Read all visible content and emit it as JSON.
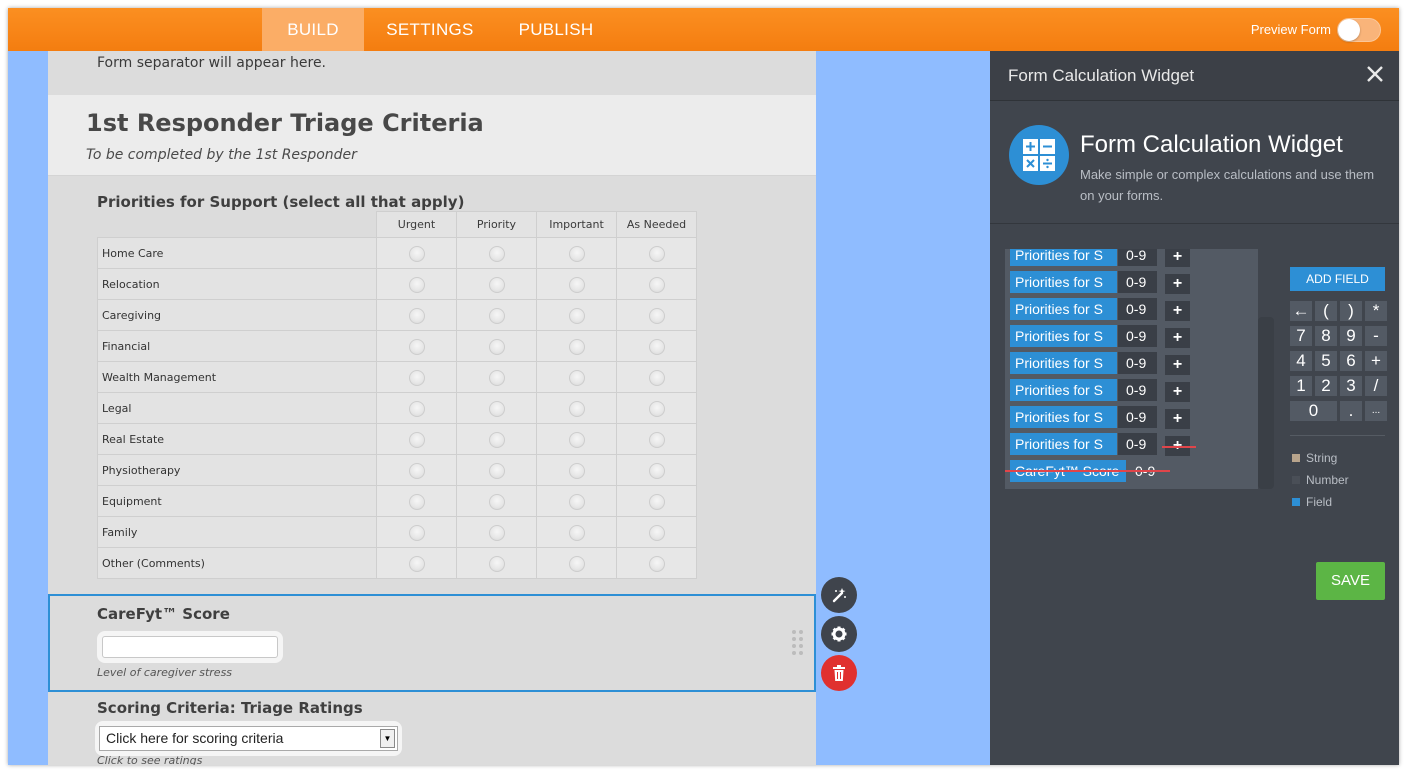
{
  "topbar": {
    "tabs": [
      {
        "label": "BUILD"
      },
      {
        "label": "SETTINGS"
      },
      {
        "label": "PUBLISH"
      }
    ],
    "preview_label": "Preview Form",
    "accent": "#f58512",
    "active_tab": "BUILD"
  },
  "form": {
    "separator_text": "Form separator will appear here.",
    "title": "1st Responder Triage Criteria",
    "subtitle": "To be completed by the 1st Responder",
    "priorities": {
      "label": "Priorities for Support (select all that apply)",
      "columns": [
        "Urgent",
        "Priority",
        "Important",
        "As Needed"
      ],
      "rows": [
        "Home Care",
        "Relocation",
        "Caregiving",
        "Financial",
        "Wealth Management",
        "Legal",
        "Real Estate",
        "Physiotherapy",
        "Equipment",
        "Family",
        "Other (Comments)"
      ]
    },
    "score": {
      "label": "CareFyt™ Score",
      "value": "",
      "sublabel": "Level of caregiver stress"
    },
    "scoring": {
      "label": "Scoring Criteria: Triage Ratings",
      "selected": "Click here for scoring criteria",
      "sublabel": "Click to see ratings"
    }
  },
  "tools": {
    "wand_icon": "magic-wand-icon",
    "gear_icon": "gear-icon",
    "trash_icon": "trash-icon",
    "delete_color": "#e0312f"
  },
  "panel": {
    "title": "Form Calculation Widget",
    "widget_name": "Form Calculation Widget",
    "widget_desc": "Make simple or complex calculations and use them on your forms.",
    "add_field_label": "ADD FIELD",
    "calc_rows": [
      {
        "field": "Priorities for S",
        "num": "0-9",
        "op": "+"
      },
      {
        "field": "Priorities for S",
        "num": "0-9",
        "op": "+"
      },
      {
        "field": "Priorities for S",
        "num": "0-9",
        "op": "+"
      },
      {
        "field": "Priorities for S",
        "num": "0-9",
        "op": "+"
      },
      {
        "field": "Priorities for S",
        "num": "0-9",
        "op": "+"
      },
      {
        "field": "Priorities for S",
        "num": "0-9",
        "op": "+"
      },
      {
        "field": "Priorities for S",
        "num": "0-9",
        "op": "+"
      },
      {
        "field": "Priorities for S",
        "num": "0-9",
        "op": "+"
      }
    ],
    "result_row": {
      "field": "CareFyt™ Score",
      "num": "0-9"
    },
    "keypad": [
      [
        "←",
        "(",
        ")",
        "*"
      ],
      [
        "7",
        "8",
        "9",
        "-"
      ],
      [
        "4",
        "5",
        "6",
        "+"
      ],
      [
        "1",
        "2",
        "3",
        "/"
      ],
      [
        "0",
        ".",
        "..."
      ]
    ],
    "legend": [
      {
        "label": "String",
        "color": "#b8a48c"
      },
      {
        "label": "Number",
        "color": "#4a4f57"
      },
      {
        "label": "Field",
        "color": "#2d8fd5"
      }
    ],
    "save_label": "SAVE",
    "field_color": "#2d8fd5",
    "save_color": "#5cb545"
  }
}
